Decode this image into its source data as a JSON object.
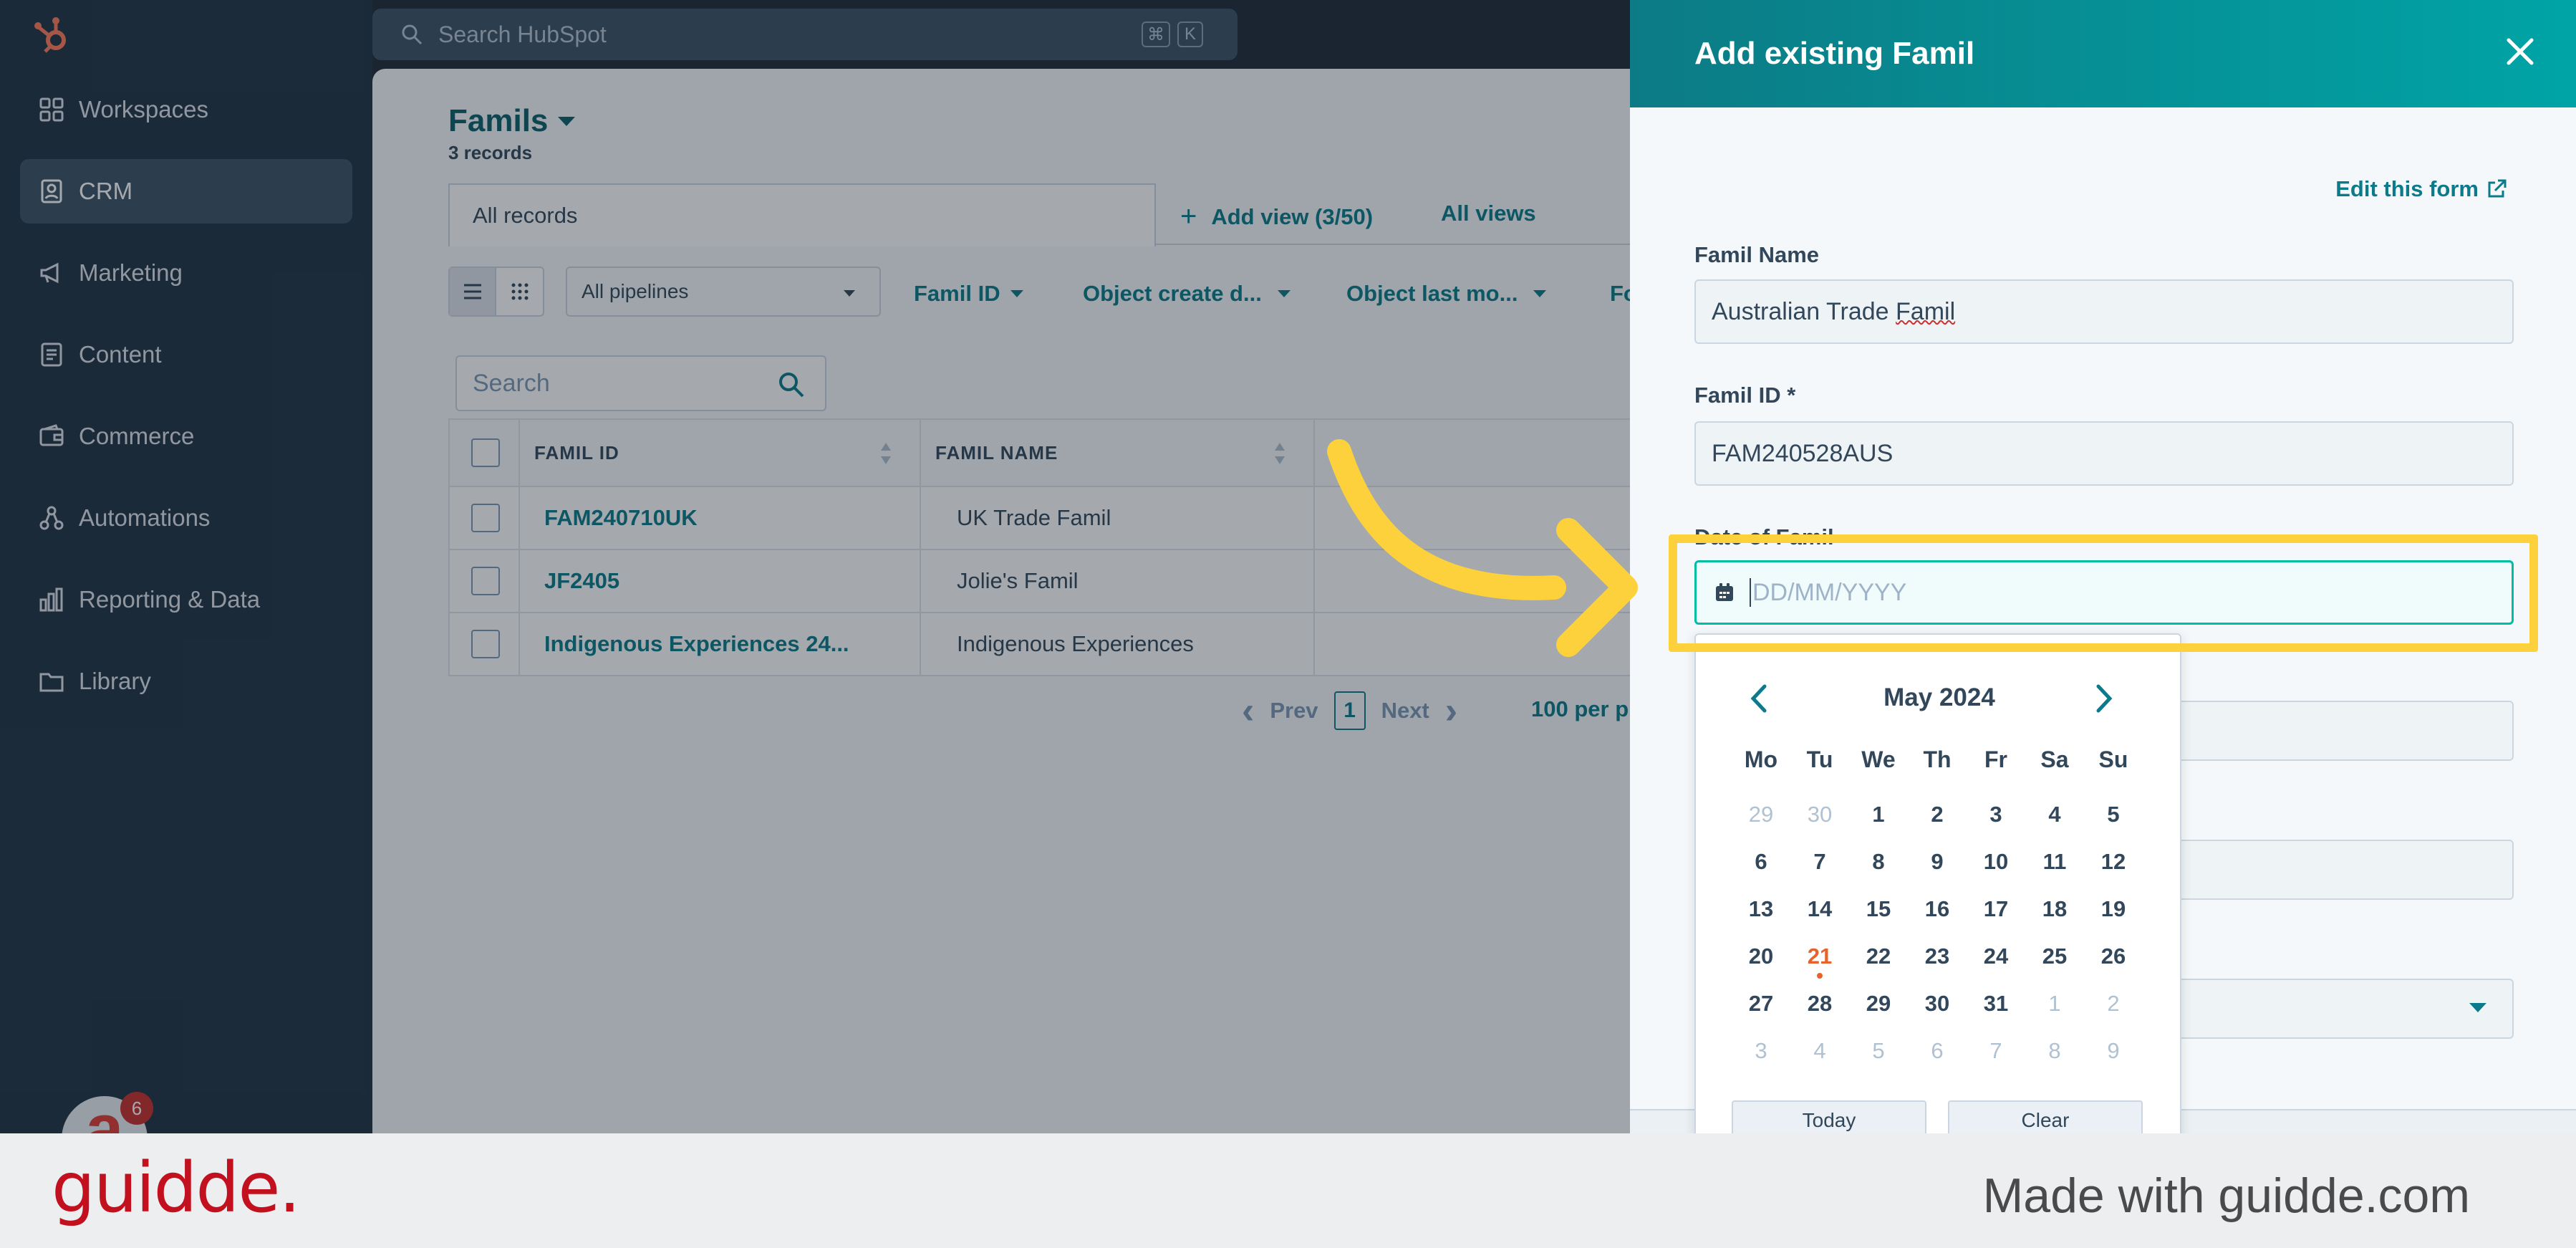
{
  "sidebar": {
    "items": [
      {
        "label": "Workspaces",
        "icon": "grid-icon"
      },
      {
        "label": "CRM",
        "icon": "contacts-icon",
        "active": true
      },
      {
        "label": "Marketing",
        "icon": "megaphone-icon"
      },
      {
        "label": "Content",
        "icon": "document-icon"
      },
      {
        "label": "Commerce",
        "icon": "wallet-icon"
      },
      {
        "label": "Automations",
        "icon": "workflow-icon"
      },
      {
        "label": "Reporting & Data",
        "icon": "bar-chart-icon"
      },
      {
        "label": "Library",
        "icon": "folder-icon"
      }
    ],
    "notification_count": "6"
  },
  "topbar": {
    "search_placeholder": "Search HubSpot",
    "shortcut_keys": [
      "⌘",
      "K"
    ]
  },
  "main": {
    "title": "Famils",
    "record_count": "3 records",
    "tabs": {
      "all_records": "All records",
      "add_view": "Add view (3/50)",
      "all_views": "All views"
    },
    "pipeline_select": "All pipelines",
    "filters": [
      "Famil ID",
      "Object create d...",
      "Object last mo...",
      "Fo"
    ],
    "table_search_placeholder": "Search",
    "columns": [
      "FAMIL ID",
      "FAMIL NAME"
    ],
    "rows": [
      {
        "id": "FAM240710UK",
        "name": "UK Trade Famil"
      },
      {
        "id": "JF2405",
        "name": "Jolie's Famil"
      },
      {
        "id": "Indigenous Experiences 24...",
        "name": "Indigenous Experiences"
      }
    ],
    "pagination": {
      "prev": "Prev",
      "current": "1",
      "next": "Next",
      "per_page": "100 per p"
    }
  },
  "panel": {
    "title": "Add existing Famil",
    "edit_form": "Edit this form",
    "fields": {
      "name_label": "Famil Name",
      "name_value_prefix": "Australian Trade ",
      "name_value_flagged": "Famil",
      "id_label": "Famil ID *",
      "id_value": "FAM240528AUS",
      "date_label": "Date of Famil",
      "date_placeholder": "DD/MM/YYYY"
    }
  },
  "calendar": {
    "month": "May 2024",
    "weekdays": [
      "Mo",
      "Tu",
      "We",
      "Th",
      "Fr",
      "Sa",
      "Su"
    ],
    "days": [
      {
        "d": "29",
        "muted": true
      },
      {
        "d": "30",
        "muted": true
      },
      {
        "d": "1"
      },
      {
        "d": "2"
      },
      {
        "d": "3"
      },
      {
        "d": "4"
      },
      {
        "d": "5"
      },
      {
        "d": "6"
      },
      {
        "d": "7"
      },
      {
        "d": "8"
      },
      {
        "d": "9"
      },
      {
        "d": "10"
      },
      {
        "d": "11"
      },
      {
        "d": "12"
      },
      {
        "d": "13"
      },
      {
        "d": "14"
      },
      {
        "d": "15"
      },
      {
        "d": "16"
      },
      {
        "d": "17"
      },
      {
        "d": "18"
      },
      {
        "d": "19"
      },
      {
        "d": "20"
      },
      {
        "d": "21",
        "today": true
      },
      {
        "d": "22"
      },
      {
        "d": "23"
      },
      {
        "d": "24"
      },
      {
        "d": "25"
      },
      {
        "d": "26"
      },
      {
        "d": "27"
      },
      {
        "d": "28"
      },
      {
        "d": "29"
      },
      {
        "d": "30"
      },
      {
        "d": "31"
      },
      {
        "d": "1",
        "muted": true
      },
      {
        "d": "2",
        "muted": true
      },
      {
        "d": "3",
        "muted": true
      },
      {
        "d": "4",
        "muted": true
      },
      {
        "d": "5",
        "muted": true
      },
      {
        "d": "6",
        "muted": true
      },
      {
        "d": "7",
        "muted": true
      },
      {
        "d": "8",
        "muted": true
      },
      {
        "d": "9",
        "muted": true
      }
    ],
    "today_button": "Today",
    "clear_button": "Clear"
  },
  "footer": {
    "brand": "guidde.",
    "tagline": "Made with guidde.com"
  },
  "colors": {
    "sidebar": "#213343",
    "accent_teal": "#0b7a8a",
    "highlight": "#fdd13b",
    "brand_red": "#c2101f"
  }
}
